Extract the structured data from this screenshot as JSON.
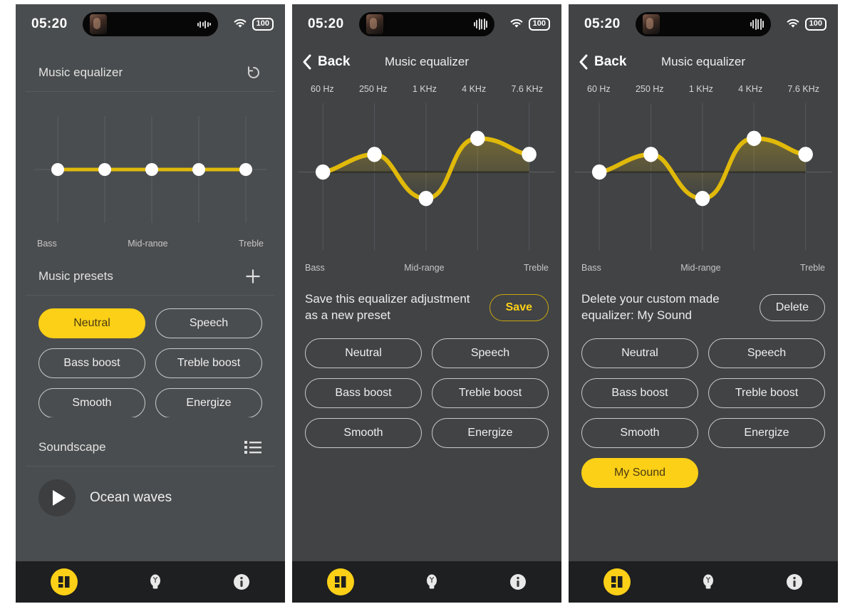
{
  "status_bar": {
    "time": "05:20",
    "battery": "100",
    "wifi_icon": "wifi-icon",
    "waveform_icon": "audio-waveform-icon",
    "island_icon": "dynamic-island-artwork"
  },
  "panels": [
    {
      "id": "panel-home",
      "nav": null,
      "equalizer_card": {
        "title": "Music equalizer",
        "reset_icon": "reset-icon",
        "axis_labels": [
          "Bass",
          "Mid-range",
          "Treble"
        ]
      },
      "presets_card": {
        "title": "Music presets",
        "add_icon": "plus-icon",
        "presets": [
          {
            "label": "Neutral",
            "selected": true
          },
          {
            "label": "Speech",
            "selected": false
          },
          {
            "label": "Bass boost",
            "selected": false
          },
          {
            "label": "Treble boost",
            "selected": false
          },
          {
            "label": "Smooth",
            "selected": false
          },
          {
            "label": "Energize",
            "selected": false
          }
        ]
      },
      "soundscape_card": {
        "title": "Soundscape",
        "list_icon": "list-icon",
        "play_icon": "play-icon",
        "track": "Ocean waves"
      }
    },
    {
      "id": "panel-save",
      "nav": {
        "back_label": "Back",
        "back_icon": "chevron-left-icon",
        "title": "Music equalizer"
      },
      "frequencies": [
        "60 Hz",
        "250 Hz",
        "1 KHz",
        "4 KHz",
        "7.6 KHz"
      ],
      "axis_labels": [
        "Bass",
        "Mid-range",
        "Treble"
      ],
      "action": {
        "text": "Save this equalizer adjustment as a new preset",
        "button": "Save",
        "accent": true
      },
      "presets": [
        {
          "label": "Neutral",
          "selected": false
        },
        {
          "label": "Speech",
          "selected": false
        },
        {
          "label": "Bass boost",
          "selected": false
        },
        {
          "label": "Treble boost",
          "selected": false
        },
        {
          "label": "Smooth",
          "selected": false
        },
        {
          "label": "Energize",
          "selected": false
        }
      ]
    },
    {
      "id": "panel-delete",
      "nav": {
        "back_label": "Back",
        "back_icon": "chevron-left-icon",
        "title": "Music equalizer"
      },
      "frequencies": [
        "60 Hz",
        "250 Hz",
        "1 KHz",
        "4 KHz",
        "7.6 KHz"
      ],
      "axis_labels": [
        "Bass",
        "Mid-range",
        "Treble"
      ],
      "action": {
        "text": "Delete your custom made equalizer: My Sound",
        "button": "Delete",
        "accent": false
      },
      "presets": [
        {
          "label": "Neutral",
          "selected": false
        },
        {
          "label": "Speech",
          "selected": false
        },
        {
          "label": "Bass boost",
          "selected": false
        },
        {
          "label": "Treble boost",
          "selected": false
        },
        {
          "label": "Smooth",
          "selected": false
        },
        {
          "label": "Energize",
          "selected": false
        },
        {
          "label": "My Sound",
          "selected": true
        }
      ]
    }
  ],
  "bottom_nav": [
    {
      "name": "equalizer-tab",
      "icon": "equalizer-icon",
      "selected": true
    },
    {
      "name": "tips-tab",
      "icon": "lightbulb-icon",
      "selected": false
    },
    {
      "name": "info-tab",
      "icon": "info-icon",
      "selected": false
    }
  ],
  "colors": {
    "accent": "#fbd017",
    "page_bg": "#414345",
    "card_bg": "#4a4d4f",
    "nav_bg": "#1e1f20",
    "curve": "#e0b90a"
  },
  "chart_data": [
    {
      "type": "line",
      "title": "Music equalizer",
      "id": "eq-flat",
      "categories": [
        "60 Hz",
        "250 Hz",
        "1 KHz",
        "4 KHz",
        "7.6 KHz"
      ],
      "values": [
        0,
        0,
        0,
        0,
        0
      ],
      "ylim": [
        -10,
        10
      ],
      "xlabel": "",
      "ylabel": "",
      "tick_labels": [
        "Bass",
        "Mid-range",
        "Treble"
      ],
      "grid": true,
      "legend": "none"
    },
    {
      "type": "line",
      "title": "Music equalizer",
      "id": "eq-custom",
      "categories": [
        "60 Hz",
        "250 Hz",
        "1 KHz",
        "4 KHz",
        "7.6 KHz"
      ],
      "values": [
        0,
        3.2,
        -3.5,
        6.5,
        4.2
      ],
      "ylim": [
        -10,
        10
      ],
      "xlabel": "",
      "ylabel": "",
      "tick_labels": [
        "Bass",
        "Mid-range",
        "Treble"
      ],
      "grid": true,
      "legend": "none"
    }
  ]
}
